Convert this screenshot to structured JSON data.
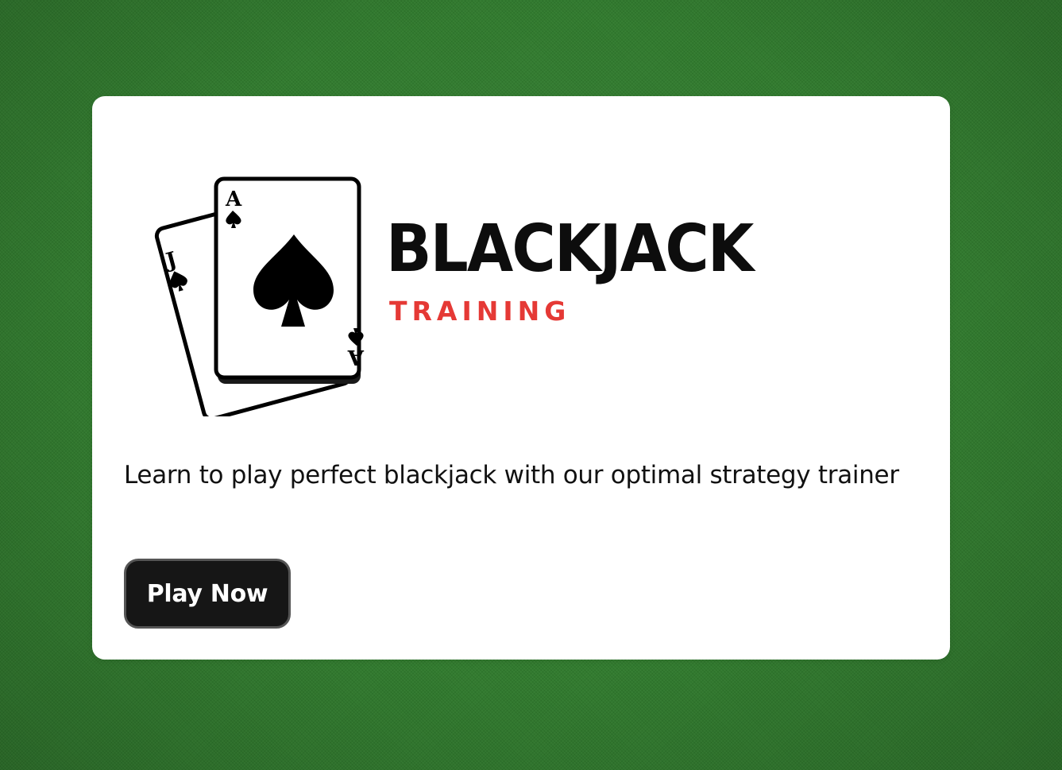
{
  "logo": {
    "title": "BLACKJACK",
    "subtitle": "TRAINING",
    "icon": "playing-cards-icon",
    "card_front_rank": "A",
    "card_back_rank": "J",
    "suit": "spade"
  },
  "intro": {
    "tagline": "Learn to play perfect blackjack with our optimal strategy trainer",
    "play_button_label": "Play Now"
  },
  "colors": {
    "felt_green": "#2f7a2c",
    "card_background": "#ffffff",
    "accent_red": "#e53935",
    "button_background": "#161616",
    "text": "#111111"
  }
}
